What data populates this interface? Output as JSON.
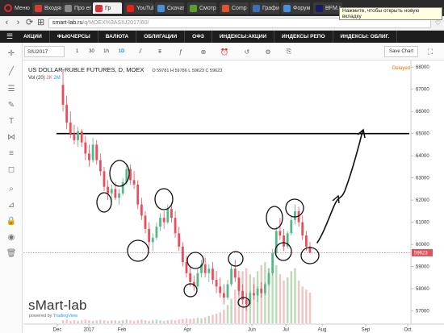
{
  "browser": {
    "menu_label": "Меню",
    "tabs": [
      {
        "label": "Входящ",
        "color": "#d23f31",
        "active": false
      },
      {
        "label": "Про ег",
        "color": "#888888",
        "active": false
      },
      {
        "label": "Гр",
        "color": "#d4353a",
        "active": true
      },
      {
        "label": "YouTub",
        "color": "#e62117",
        "active": false
      },
      {
        "label": "Скачат",
        "color": "#4a90d9",
        "active": false
      },
      {
        "label": "Смотре",
        "color": "#5aa02c",
        "active": false
      },
      {
        "label": "Comp",
        "color": "#e0552b",
        "active": false
      },
      {
        "label": "Графи",
        "color": "#3b6fb6",
        "active": false
      },
      {
        "label": "Форум",
        "color": "#4a90d9",
        "active": false
      },
      {
        "label": "BFM.r",
        "color": "#1a1a66",
        "active": false
      }
    ],
    "tooltip": "Нажмите, чтобы открыть новую вкладку",
    "url_host": "smart-lab.ru",
    "url_path": "/q/MOEX%3ASIU2017/60/"
  },
  "site_nav": {
    "items": [
      "АКЦИИ",
      "ФЬЮЧЕРСЫ",
      "ВАЛЮТА",
      "ОБЛИГАЦИИ",
      "ОФЗ",
      "ИНДЕКСЫ:АКЦИИ",
      "ИНДЕКСЫ РЕПО",
      "ИНДЕКСЫ: ОБЛИГ."
    ]
  },
  "chart_toolbar": {
    "symbol": "SIU2017",
    "timeframes": [
      "1",
      "30",
      "1h",
      "1D"
    ],
    "selected_timeframe": "1D",
    "save_label": "Save Chart"
  },
  "chart_header": {
    "title": "US DOLLAR-RUBLE FUTURES, D, MOEX",
    "open_label": "O",
    "open": "59781",
    "high_label": "H",
    "high": "59786",
    "low_label": "L",
    "low": "59623",
    "close_label": "C",
    "close": "59623",
    "volume_label": "Vol (20)",
    "volume_v1": "2K",
    "volume_v2": "2M",
    "delayed": "Delayed"
  },
  "branding": {
    "watermark": "sMart-lab",
    "powered_prefix": "powered by",
    "powered_brand": "TradingView"
  },
  "chart_data": {
    "type": "candlestick",
    "y_ticks": [
      "68000",
      "67000",
      "66000",
      "65000",
      "64000",
      "63000",
      "62000",
      "61000",
      "60000",
      "59000",
      "58000",
      "57000"
    ],
    "x_ticks": [
      "Dec",
      "2017",
      "Feb",
      "Apr",
      "Jun",
      "Jul",
      "Aug",
      "Sep",
      "Oct"
    ],
    "ylim": [
      56400,
      68300
    ],
    "last_price": "59623",
    "last_price_color": "#e0525c",
    "resistance_level": 65000,
    "candles": [
      [
        67200,
        67900,
        66000,
        66300
      ],
      [
        66300,
        66700,
        65200,
        65500
      ],
      [
        65500,
        66000,
        64800,
        65000
      ],
      [
        65000,
        65400,
        64500,
        64700
      ],
      [
        64700,
        65300,
        64400,
        65100
      ],
      [
        65100,
        65200,
        64400,
        64600
      ],
      [
        64600,
        64900,
        63800,
        64100
      ],
      [
        64100,
        64500,
        63500,
        63800
      ],
      [
        63800,
        64800,
        63700,
        64500
      ],
      [
        64500,
        64700,
        63600,
        63800
      ],
      [
        63800,
        64100,
        63100,
        63300
      ],
      [
        63300,
        63500,
        62400,
        62600
      ],
      [
        62600,
        62900,
        62000,
        62300
      ],
      [
        62300,
        62700,
        61900,
        62500
      ],
      [
        62500,
        62800,
        62000,
        62100
      ],
      [
        62100,
        62500,
        61800,
        62300
      ],
      [
        62300,
        63000,
        62200,
        62800
      ],
      [
        62800,
        63600,
        62700,
        63400
      ],
      [
        63400,
        63600,
        62700,
        62900
      ],
      [
        62900,
        63300,
        62500,
        62700
      ],
      [
        62700,
        62900,
        61600,
        61800
      ],
      [
        61800,
        62100,
        61100,
        61300
      ],
      [
        61300,
        61500,
        60500,
        60700
      ],
      [
        60700,
        61000,
        59800,
        60100
      ],
      [
        60100,
        60500,
        59700,
        60300
      ],
      [
        60300,
        61000,
        60200,
        60800
      ],
      [
        60800,
        61400,
        60600,
        61200
      ],
      [
        61200,
        61500,
        60700,
        61000
      ],
      [
        61000,
        61800,
        60900,
        61600
      ],
      [
        61600,
        61900,
        61000,
        61200
      ],
      [
        61200,
        61500,
        60300,
        60500
      ],
      [
        60500,
        60800,
        59700,
        59900
      ],
      [
        59900,
        60100,
        59000,
        59200
      ],
      [
        59200,
        59500,
        58500,
        58700
      ],
      [
        58700,
        59000,
        58100,
        58300
      ],
      [
        58300,
        58600,
        57900,
        58100
      ],
      [
        58100,
        58900,
        58000,
        58700
      ],
      [
        58700,
        59300,
        58500,
        59100
      ],
      [
        59100,
        59400,
        58500,
        58700
      ],
      [
        58700,
        59100,
        58300,
        58900
      ],
      [
        58900,
        59200,
        58200,
        58400
      ],
      [
        58400,
        58800,
        57800,
        58100
      ],
      [
        58100,
        58500,
        57600,
        57800
      ],
      [
        57800,
        58200,
        57300,
        57600
      ],
      [
        57600,
        58400,
        57500,
        58200
      ],
      [
        58200,
        59100,
        58100,
        58900
      ],
      [
        58900,
        59300,
        58300,
        58500
      ],
      [
        58500,
        58800,
        57700,
        57900
      ],
      [
        57900,
        58200,
        57300,
        57500
      ],
      [
        57500,
        57800,
        57000,
        57300
      ],
      [
        57300,
        57900,
        57200,
        57800
      ],
      [
        57800,
        58200,
        57500,
        57700
      ],
      [
        57700,
        58100,
        57400,
        58000
      ],
      [
        58000,
        58300,
        57600,
        57800
      ],
      [
        57800,
        58300,
        57700,
        58200
      ],
      [
        58200,
        58900,
        58100,
        58700
      ],
      [
        58700,
        59800,
        58600,
        59600
      ],
      [
        59600,
        60800,
        59400,
        60600
      ],
      [
        60600,
        61200,
        60200,
        60400
      ],
      [
        60400,
        60700,
        59700,
        59900
      ],
      [
        59900,
        60600,
        59800,
        60500
      ],
      [
        60500,
        61300,
        60400,
        61100
      ],
      [
        61100,
        61800,
        60900,
        61500
      ],
      [
        61500,
        61700,
        60800,
        61000
      ],
      [
        61000,
        61300,
        60200,
        60400
      ],
      [
        60400,
        60600,
        59700,
        59900
      ],
      [
        59900,
        60100,
        59600,
        59623
      ]
    ],
    "volumes": [
      5,
      6,
      4,
      5,
      4,
      5,
      6,
      5,
      4,
      5,
      6,
      5,
      4,
      5,
      5,
      4,
      5,
      6,
      5,
      4,
      5,
      6,
      5,
      4,
      5,
      6,
      5,
      4,
      5,
      6,
      5,
      6,
      7,
      8,
      7,
      8,
      9,
      8,
      10,
      12,
      14,
      16,
      18,
      22,
      30,
      40,
      55,
      70,
      85,
      90,
      80,
      75,
      85,
      95,
      100,
      90,
      85,
      95,
      80,
      70,
      75,
      85,
      90,
      70,
      60,
      55,
      50
    ]
  }
}
